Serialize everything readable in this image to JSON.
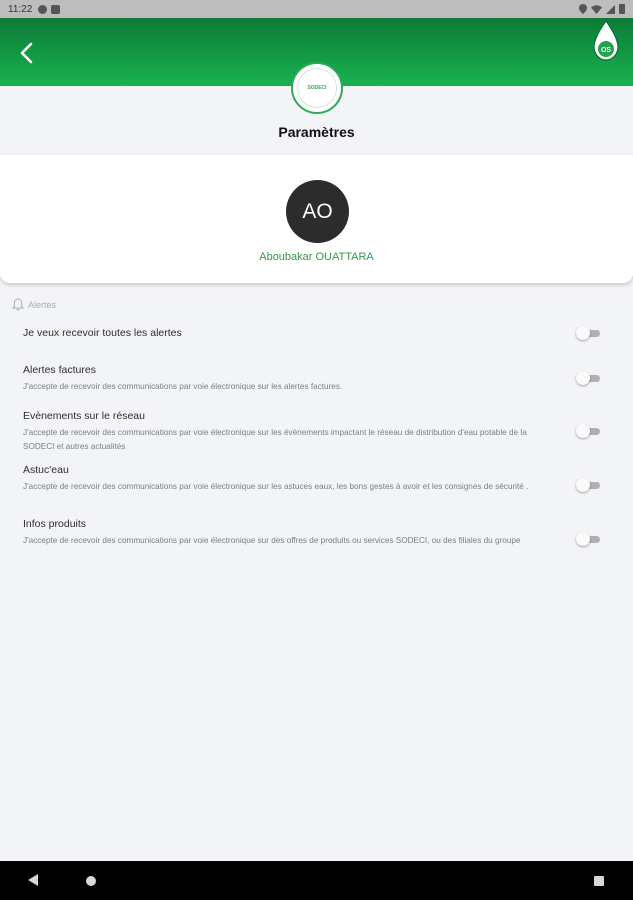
{
  "status_bar": {
    "time": "11:22"
  },
  "header": {
    "brand_logo_text": "SODECI",
    "drop_logo_text": "OS"
  },
  "page": {
    "title": "Paramètres"
  },
  "profile": {
    "initials": "AO",
    "name": "Aboubakar OUATTARA"
  },
  "alerts": {
    "section_label": "Alertes",
    "items": [
      {
        "title": "Je veux recevoir toutes les alertes",
        "description": ""
      },
      {
        "title": "Alertes factures",
        "description": "J'accepte de recevoir des communications par voie électronique sur les alertes factures."
      },
      {
        "title": "Evènements sur le réseau",
        "description": "J'accepte de recevoir des communications par voie électronique sur les évènements impactant le réseau de distribution d'eau potable de la SODECI et autres actualités"
      },
      {
        "title": "Astuc'eau",
        "description": "J'accepte de recevoir des communications par voie électronique sur les astuces eaux, les bons gestes à avoir et les consignes de sécurité ."
      },
      {
        "title": "Infos produits",
        "description": "J'accepte de recevoir des communications par voie électronique sur des offres de produits ou services SODECI, ou des filiales du groupe"
      }
    ],
    "toggle_states": [
      false,
      false,
      false,
      false,
      false
    ]
  },
  "colors": {
    "header_green": "#129a45",
    "accent_green": "#2e9a4e",
    "avatar_bg": "#2c2c2c"
  },
  "icons": {
    "back": "arrow-left-icon",
    "alerts": "bell-icon",
    "logo": "water-drop-icon"
  }
}
